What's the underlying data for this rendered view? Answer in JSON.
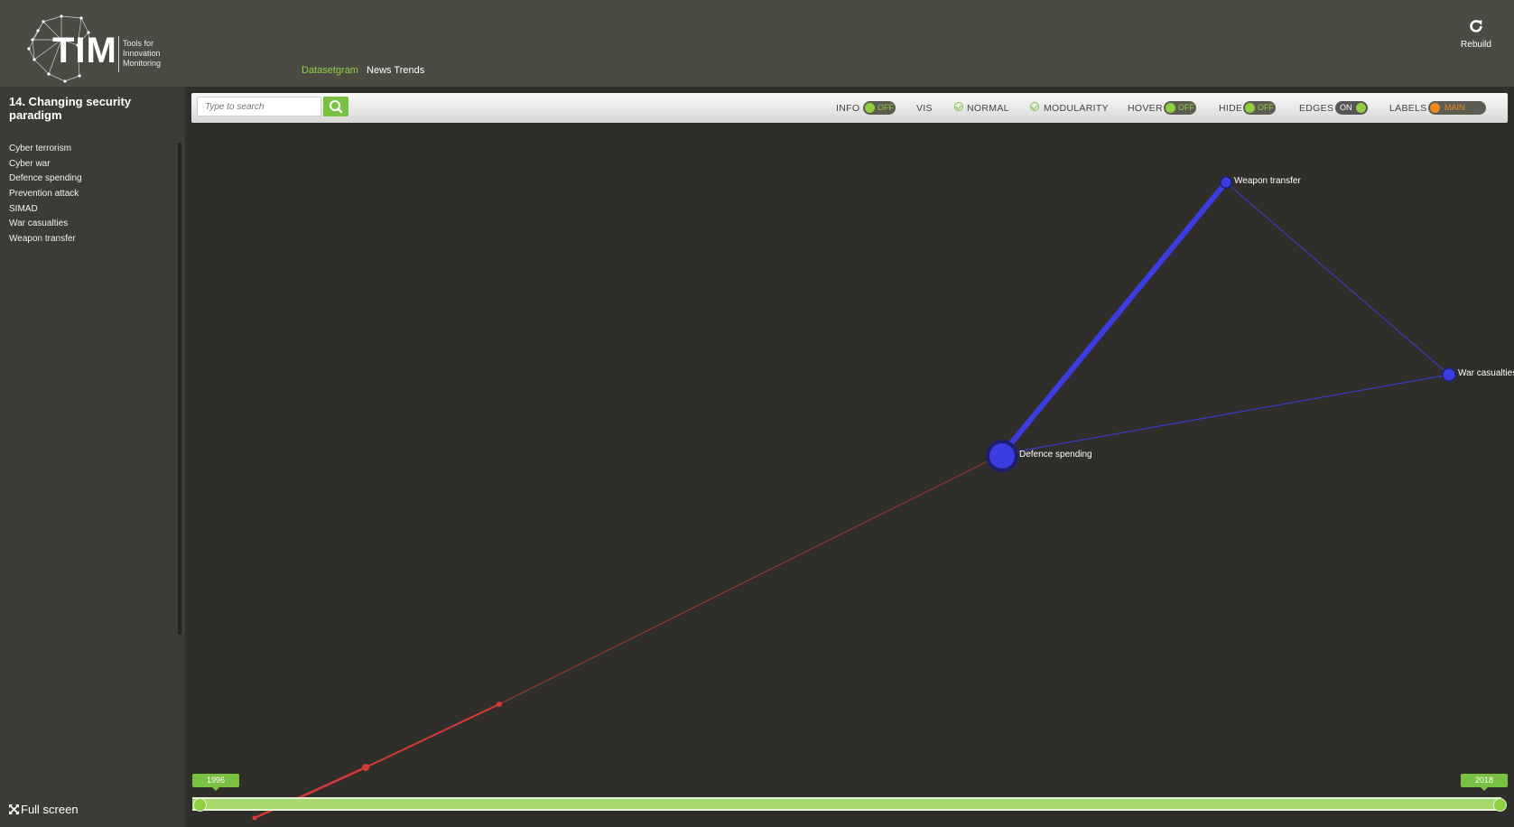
{
  "header": {
    "logo_text": "TIM",
    "logo_tagline": "Tools for Innovation Monitoring",
    "nav": [
      {
        "label": "Datasetgram",
        "active": true
      },
      {
        "label": "News Trends",
        "active": false
      }
    ],
    "rebuild_label": "Rebuild",
    "rebuild_icon": "refresh-icon"
  },
  "sidebar": {
    "title": "14. Changing security paradigm",
    "items": [
      "Cyber terrorism",
      "Cyber war",
      "Defence spending",
      "Prevention attack",
      "SIMAD",
      "War casualties",
      "Weapon transfer"
    ],
    "fullscreen_label": "Full screen",
    "fullscreen_icon": "expand-icon"
  },
  "toolbar": {
    "search_placeholder": "Type to search",
    "search_icon": "search-icon",
    "info_label": "INFO",
    "info_state": "OFF",
    "vis_label": "VIS",
    "normal_label": "NORMAL",
    "modularity_label": "MODULARITY",
    "hover_label": "HOVER",
    "hover_state": "OFF",
    "hide_label": "HIDE",
    "hide_state": "OFF",
    "edges_label": "EDGES",
    "edges_state": "ON",
    "labels_label": "LABELS",
    "labels_state": "MAIN"
  },
  "graph": {
    "nodes": [
      {
        "id": "defence",
        "label": "Defence spending",
        "color": "#3b3de0",
        "size": "large"
      },
      {
        "id": "weapon",
        "label": "Weapon transfer",
        "color": "#3b3de0",
        "size": "small"
      },
      {
        "id": "war",
        "label": "War casualties",
        "color": "#3b3de0",
        "size": "small"
      }
    ],
    "blue_color": "#3b3de0",
    "red_color": "#d63a35"
  },
  "timeline": {
    "start_year": "1996",
    "end_year": "2018",
    "accent": "#7ac142"
  }
}
